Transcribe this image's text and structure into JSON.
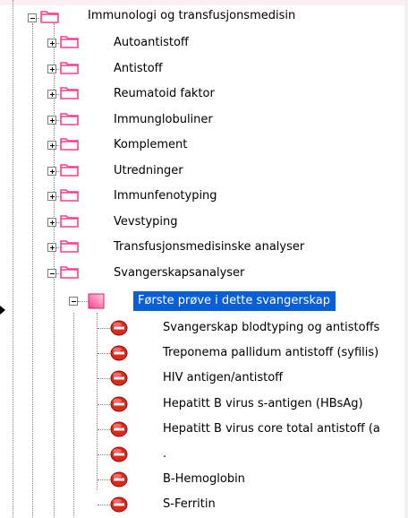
{
  "tree": {
    "root": {
      "label": "Immunologi og transfusjonsmedisin"
    },
    "groups": [
      {
        "label": "Autoantistoff"
      },
      {
        "label": "Antistoff"
      },
      {
        "label": "Reumatoid faktor"
      },
      {
        "label": "Immunglobuliner"
      },
      {
        "label": "Komplement"
      },
      {
        "label": "Utredninger"
      },
      {
        "label": "Immunfenotyping"
      },
      {
        "label": "Vevstyping"
      },
      {
        "label": "Transfusjonsmedisinske analyser"
      },
      {
        "label": "Svangerskapsanalyser"
      }
    ],
    "subgroup": {
      "label": "Første prøve i dette svangerskap"
    },
    "items": [
      {
        "label": "Svangerskap blodtyping og antistoffs"
      },
      {
        "label": "Treponema pallidum antistoff (syfilis)"
      },
      {
        "label": "HIV antigen/antistoff"
      },
      {
        "label": "Hepatitt B virus s-antigen (HBsAg)"
      },
      {
        "label": "Hepatitt B virus core total antistoff (a"
      },
      {
        "label": "."
      },
      {
        "label": "B-Hemoglobin"
      },
      {
        "label": "S-Ferritin"
      }
    ]
  },
  "colors": {
    "folder": "#ff3f8f",
    "selection": "#0a5fd6",
    "stop": "#e0271b"
  }
}
